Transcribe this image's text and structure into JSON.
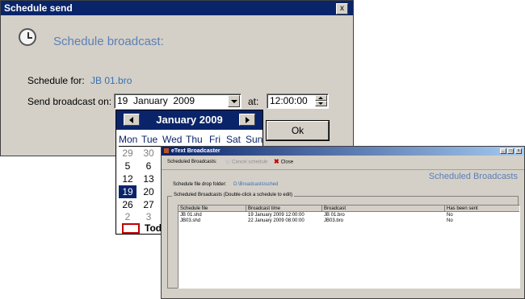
{
  "schedule_dialog": {
    "title": "Schedule send",
    "close_label": "x",
    "heading": "Schedule broadcast:",
    "schedule_for_label": "Schedule for:",
    "schedule_for_value": "JB 01.bro",
    "send_on_label": "Send broadcast on:",
    "date_value": "19  January  2009",
    "at_label": "at:",
    "time_value": "12:00:00",
    "ok_label": "Ok"
  },
  "calendar": {
    "month_title": "January 2009",
    "weekdays": [
      "Mon",
      "Tue",
      "Wed",
      "Thu",
      "Fri",
      "Sat",
      "Sun"
    ],
    "rows": [
      [
        "29",
        "30"
      ],
      [
        "5",
        "6"
      ],
      [
        "12",
        "13"
      ],
      [
        "19",
        "20"
      ],
      [
        "26",
        "27"
      ],
      [
        "2",
        "3"
      ]
    ],
    "selected_day": "19",
    "today_label": "Tod"
  },
  "broadcaster": {
    "title": "eText Broadcaster",
    "window_controls": [
      "_",
      "□",
      "x"
    ],
    "toolbar": {
      "label": "Scheduled Broadcasts:",
      "cancel_schedule": "Cancel schedule",
      "close": "Close"
    },
    "page_title": "Scheduled Broadcasts",
    "drop_folder_label": "Schedule file drop folder:",
    "drop_folder_value": "D:\\Broadcasts\\sched",
    "group_label": "Scheduled Broadcasts (Double-click a schedule to edit)",
    "columns": [
      "Schedule file",
      "Broadcast time",
      "Broadcast",
      "Has been sent"
    ],
    "rows": [
      [
        "JB 01.shd",
        "19 January 2009 12:00:00",
        "JB 01.bro",
        "No"
      ],
      [
        "JB03.shd",
        "22 January 2009 08:00:00",
        "JB03.bro",
        "No"
      ]
    ]
  },
  "colors": {
    "titlebar": "#0a246a",
    "window_bg": "#d4d0c8",
    "accent_text": "#5b7fb6",
    "link": "#3a6fb0"
  }
}
